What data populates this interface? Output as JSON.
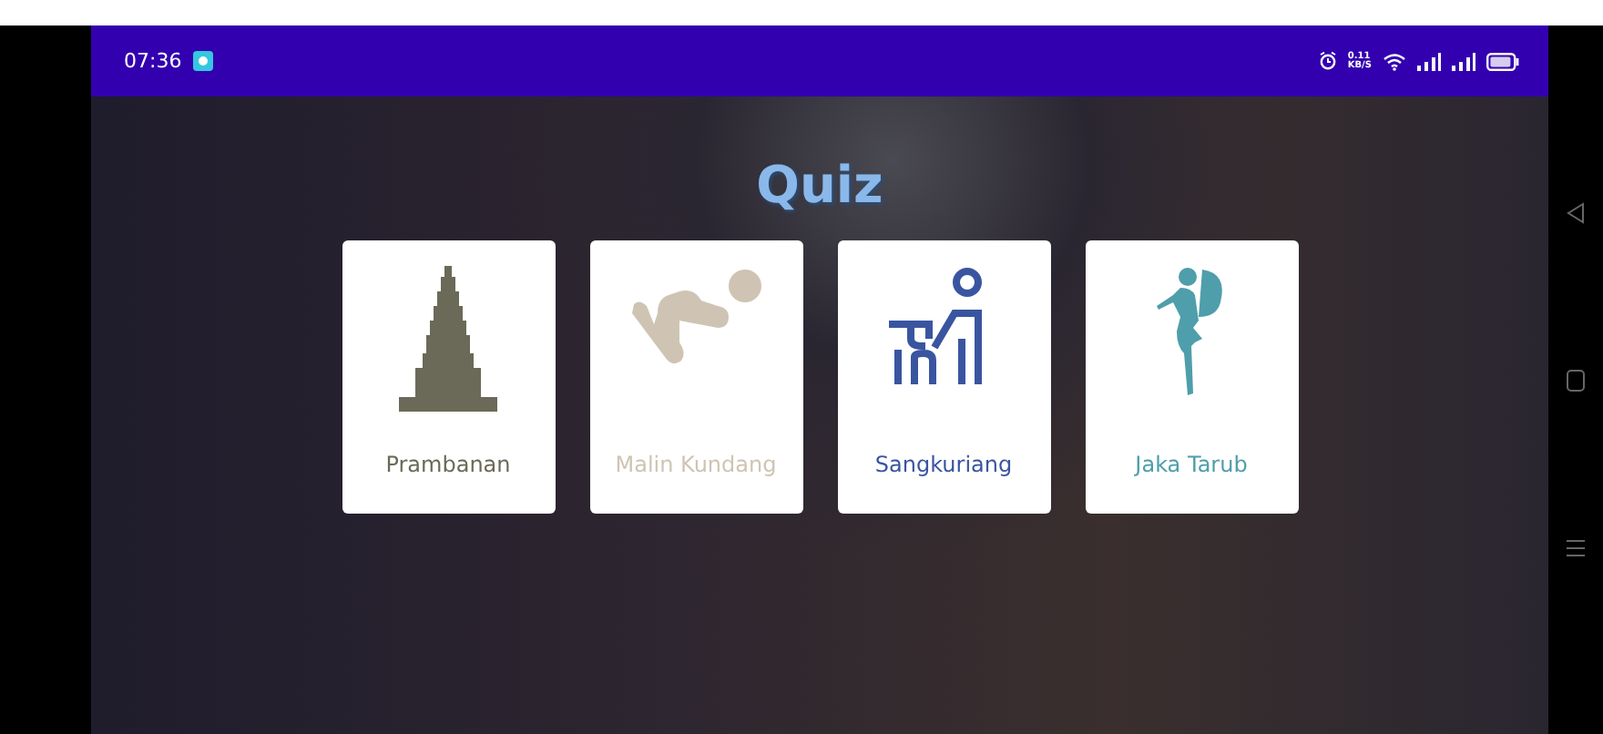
{
  "status_bar": {
    "time": "07:36",
    "speed_value": "0.11",
    "speed_unit": "KB/S"
  },
  "title": "Quiz",
  "cards": [
    {
      "label": "Prambanan",
      "kind": "temple",
      "color": "#6b6a58"
    },
    {
      "label": "Malin Kundang",
      "kind": "kneeling",
      "color": "#cfc4b3"
    },
    {
      "label": "Sangkuriang",
      "kind": "person-table",
      "color": "#3a55a0"
    },
    {
      "label": "Jaka Tarub",
      "kind": "fairy",
      "color": "#4f9eab"
    }
  ]
}
